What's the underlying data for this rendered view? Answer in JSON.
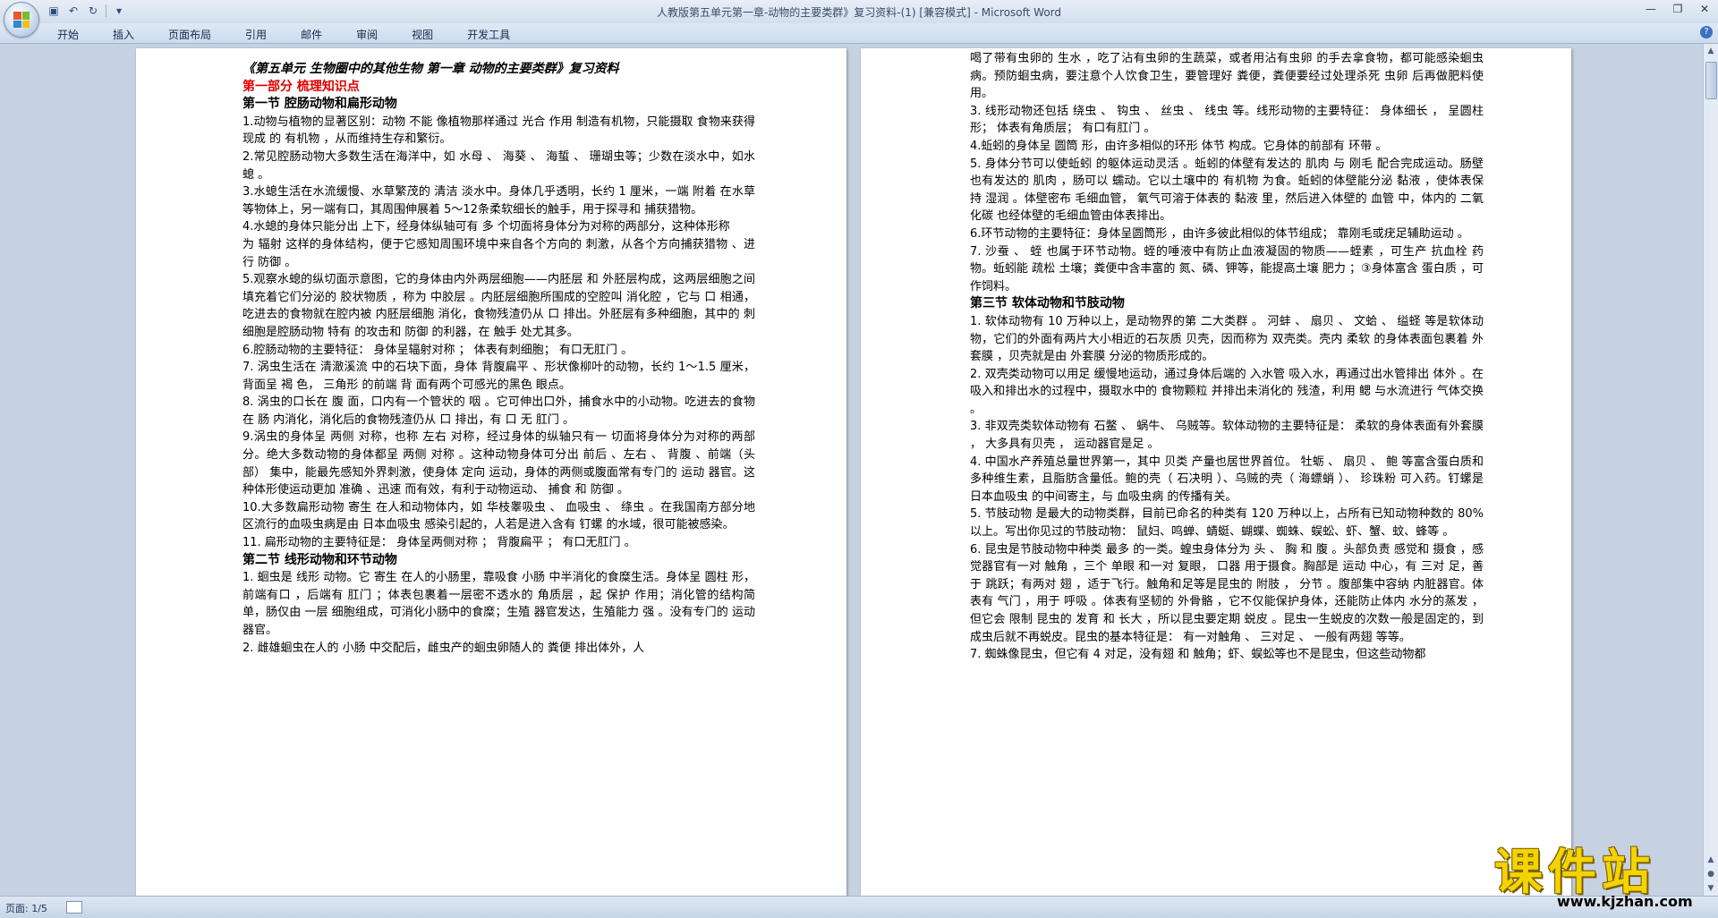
{
  "window": {
    "title": "人教版第五单元第一章-动物的主要类群》复习资料-(1) [兼容模式] - Microsoft Word",
    "controls": [
      "—",
      "❐",
      "✕"
    ]
  },
  "qat": {
    "save_icon": "floppy-disk-icon",
    "undo_icon": "undo-icon",
    "redo_icon": "redo-icon"
  },
  "ribbon": {
    "tabs": [
      "开始",
      "插入",
      "页面布局",
      "引用",
      "邮件",
      "审阅",
      "视图",
      "开发工具"
    ]
  },
  "left_page": {
    "doc_title": "《第五单元 生物圈中的其他生物 第一章 动物的主要类群》复习资料",
    "part": "第一部分 梳理知识点",
    "section1": "第一节 腔肠动物和扁形动物",
    "paragraphs": [
      "1.动物与植物的显著区别：动物 不能 像植物那样通过 光合 作用 制造有机物，只能摄取 食物来获得 现成 的 有机物 ，从而维持生存和繁衍。",
      "2.常见腔肠动物大多数生活在海洋中，如 水母 、 海葵 、 海蜇 、 珊瑚虫等；少数在淡水中，如水螅 。",
      "3.水螅生活在水流缓慢、水草繁茂的 清洁 淡水中。身体几乎透明，长约 1 厘米，一端 附着 在水草等物体上，另一端有口，其周围伸展着 5～12条柔软细长的触手，用于探寻和 捕获猎物。",
      "4.水螅的身体只能分出 上下，经身体纵轴可有 多 个切面将身体分为对称的两部分，这种体形称",
      "为 辐射 这样的身体结构，便于它感知周围环境中来自各个方向的 刺激，从各个方向捕获猎物 、进行 防御 。",
      "5.观察水螅的纵切面示意图，它的身体由内外两层细胞——内胚层 和 外胚层构成，这两层细胞之间填充着它们分泌的 胶状物质 ，称为 中胶层 。内胚层细胞所围成的空腔叫 消化腔 ，它与 口 相通，吃进去的食物就在腔内被 内胚层细胞 消化，食物残渣仍从 口 排出。外胚层有多种细胞，其中的 刺细胞是腔肠动物 特有 的攻击和 防御 的利器，在 触手 处尤其多。",
      "6.腔肠动物的主要特征： 身体呈辐射对称 ； 体表有刺细胞； 有口无肛门 。",
      "7. 涡虫生活在 清澈溪流 中的石块下面，身体 背腹扁平 、形状像柳叶的动物，长约 1～1.5 厘米，背面呈 褐 色， 三角形 的前端 背 面有两个可感光的黑色 眼点。",
      "8. 涡虫的口长在 腹 面，口内有一个管状的 咽 。它可伸出口外，捕食水中的小动物。吃进去的食物在 肠 内消化，消化后的食物残渣仍从 口 排出，有 口 无 肛门 。",
      "9.涡虫的身体呈 两侧 对称，也称 左右 对称，经过身体的纵轴只有一 切面将身体分为对称的两部分。绝大多数动物的身体都呈 两侧 对称 。这种动物身体可分出 前后 、左右 、 背腹 、前端（头部） 集中，能最先感知外界刺激，使身体 定向 运动，身体的两侧或腹面常有专门的 运动 器官。这种体形使运动更加 准确 、迅速 而有效，有利于动物运动、 捕食 和 防御 。",
      "10.大多数扁形动物 寄生 在人和动物体内，如 华枝睾吸虫 、 血吸虫 、 绦虫 。在我国南方部分地区流行的血吸虫病是由 日本血吸虫 感染引起的，人若是进入含有 钉螺 的水域，很可能被感染。",
      "11. 扁形动物的主要特征是： 身体呈两侧对称 ； 背腹扁平 ； 有口无肛门 。"
    ],
    "section2": "第二节 线形动物和环节动物",
    "paragraphs2": [
      "1. 蛔虫是 线形 动物。它 寄生 在人的小肠里，靠吸食 小肠 中半消化的食糜生活。身体呈 圆柱 形，前端有口 ，后端有 肛门 ；体表包裹着一层密不透水的 角质层 ，起 保护 作用；消化管的结构简单，肠仅由 一层 细胞组成，可消化小肠中的食糜；生殖 器官发达，生殖能力 强 。没有专门的 运动 器官。",
      "2. 雌雄蛔虫在人的 小肠 中交配后，雌虫产的蛔虫卵随人的 粪便 排出体外，人"
    ]
  },
  "right_page": {
    "paragraphs": [
      "喝了带有虫卵的 生水 ，吃了沾有虫卵的生蔬菜，或者用沾有虫卵 的手去拿食物，都可能感染蛔虫病。预防蛔虫病，要注意个人饮食卫生，要管理好 粪便，粪便要经过处理杀死 虫卵 后再做肥料使用。",
      "3. 线形动物还包括 绕虫 、 钩虫 、 丝虫 、 线虫 等。线形动物的主要特征： 身体细长 ， 呈圆柱形； 体表有角质层； 有口有肛门 。",
      "4.蚯蚓的身体呈 圆筒 形，由许多相似的环形 体节 构成。它身体的前部有 环带 。",
      "5. 身体分节可以使蚯蚓 的躯体运动灵活 。蚯蚓的体壁有发达的 肌肉 与 刚毛 配合完成运动。肠壁也有发达的 肌肉 ，肠可以 蠕动。它以土壤中的 有机物 为食。蚯蚓的体壁能分泌 黏液 ，使体表保持 湿润 。体壁密布 毛细血管， 氧气可溶于体表的 黏液 里，然后进入体壁的 血管 中，体内的 二氧化碳 也经体壁的毛细血管由体表排出。",
      "6.环节动物的主要特征：身体呈圆筒形 ，由许多彼此相似的体节组成； 靠刚毛或疣足辅助运动 。",
      "7. 沙蚕 、 蛭 也属于环节动物。蛭的唾液中有防止血液凝固的物质——蛭素 ，可生产 抗血栓 药物。蚯蚓能 疏松 土壤；粪便中含丰富的 氮、磷、钾等，能提高土壤 肥力 ；③身体富含 蛋白质 ，可作饲料。"
    ],
    "section3": "第三节 软体动物和节肢动物",
    "paragraphs2": [
      "1. 软体动物有 10 万种以上，是动物界的第 二大类群 。 河蚌 、 扇贝 、 文蛤 、 缢蛏 等是软体动物，它们的外面有两片大小相近的石灰质 贝壳，因而称为 双壳类。壳内 柔软 的身体表面包裹着 外套膜 ，贝壳就是由 外套膜 分泌的物质形成的。",
      "2. 双壳类动物可以用足 缓慢地运动，通过身体后端的 入水管 吸入水，再通过出水管排出 体外 。在吸入和排出水的过程中，摄取水中的 食物颗粒 并排出未消化的 残渣，利用 鳃 与水流进行 气体交换 。",
      "3. 非双壳类软体动物有 石鳖 、 蜗牛、 乌贼等。软体动物的主要特征是： 柔软的身体表面有外套膜 ， 大多具有贝壳 ， 运动器官是足 。",
      "4. 中国水产养殖总量世界第一，其中 贝类 产量也居世界首位。 牡蛎 、 扇贝 、 鲍 等富含蛋白质和多种维生素，且脂肪含量低。鲍的壳（ 石决明 ）、乌贼的壳（ 海螵蛸 ）、 珍珠粉 可入药。钉螺是 日本血吸虫 的中间寄主，与 血吸虫病 的传播有关。",
      "5. 节肢动物 是最大的动物类群，目前已命名的种类有 120 万种以上，占所有已知动物种数的 80% 以上。写出你见过的节肢动物： 鼠妇、鸣蝉、蜻蜓、蝴蝶、蜘蛛、蜈蚣、虾、蟹、蚊、蜂等 。",
      "6. 昆虫是节肢动物中种类 最多 的一类。蝗虫身体分为 头 、 胸 和 腹 。头部负责 感觉和 摄食 ，感觉器官有一对 触角 ，三个 单眼 和一对 复眼， 口器 用于摄食。胸部是 运动 中心，有 三对 足，善于 跳跃；有两对 翅 ，适于飞行。触角和足等是昆虫的 附肢 ， 分节 。腹部集中容纳 内脏器官。体表有 气门 ，用于 呼吸 。体表有坚韧的 外骨骼 ，它不仅能保护身体，还能防止体内 水分的蒸发 ，但它会 限制 昆虫的 发育 和 长大 ，所以昆虫要定期 蜕皮 。昆虫一生蜕皮的次数一般是固定的，到成虫后就不再蜕皮。昆虫的基本特征是： 有一对触角 、 三对足 、 一般有两翅 等等。",
      "7. 蜘蛛像昆虫，但它有 4 对足，没有翅 和 触角；虾、蜈蚣等也不是昆虫，但这些动物都"
    ]
  },
  "status": {
    "page": "页面: 1/5"
  },
  "watermark": {
    "cn": "课件站",
    "url": "www.kjzhan.com"
  }
}
